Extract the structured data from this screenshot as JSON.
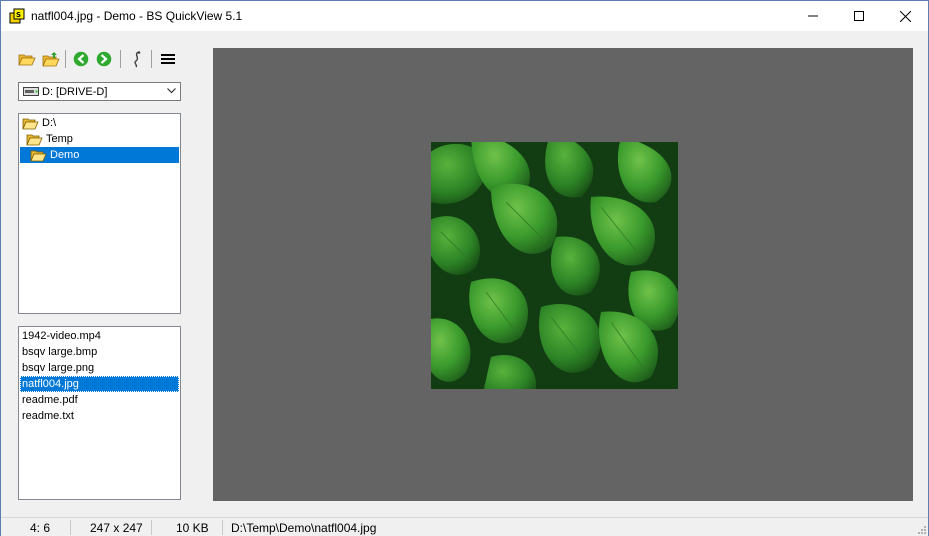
{
  "window": {
    "title": "natfl004.jpg - Demo - BS QuickView 5.1"
  },
  "toolbar": {
    "buttons": [
      "open-folder-icon",
      "folder-up-icon",
      "back-arrow-icon",
      "forward-arrow-icon",
      "info-icon",
      "menu-icon"
    ]
  },
  "drive": {
    "selected": "D: [DRIVE-D]"
  },
  "tree": {
    "items": [
      {
        "label": "D:\\",
        "depth": 0,
        "icon": "open-folder-icon"
      },
      {
        "label": "Temp",
        "depth": 1,
        "icon": "open-folder-icon"
      },
      {
        "label": "Demo",
        "depth": 2,
        "icon": "open-folder-icon",
        "selected": true
      }
    ]
  },
  "files": {
    "items": [
      {
        "label": "1942-video.mp4"
      },
      {
        "label": "bsqv large.bmp"
      },
      {
        "label": "bsqv large.png"
      },
      {
        "label": "natfl004.jpg",
        "selected": true
      },
      {
        "label": "readme.pdf"
      },
      {
        "label": "readme.txt"
      }
    ]
  },
  "viewer": {
    "background": "#646464",
    "image_subject": "green leaves"
  },
  "status": {
    "position": "4: 6",
    "dimensions": "247 x 247",
    "size": "10 KB",
    "path": "D:\\Temp\\Demo\\natfl004.jpg"
  },
  "colors": {
    "selection": "#0078d7",
    "panel": "#f0f0f0"
  }
}
